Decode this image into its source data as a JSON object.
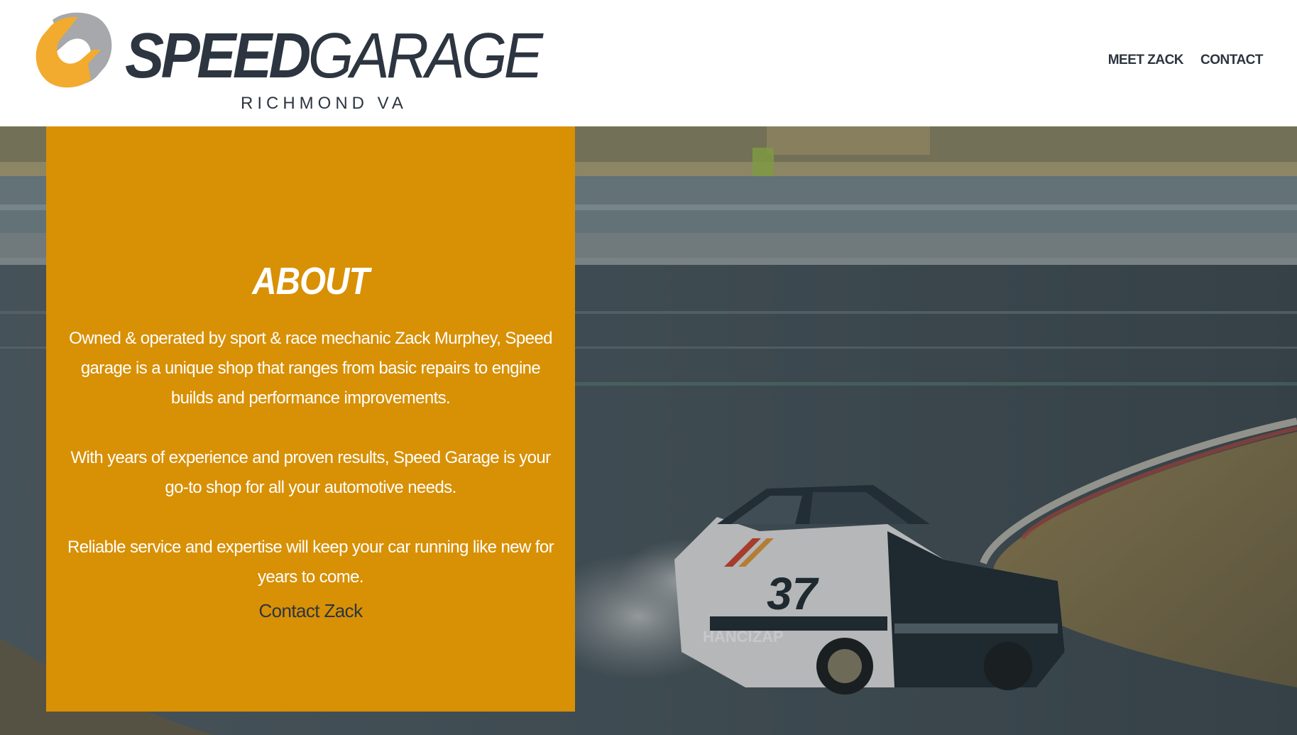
{
  "brand": {
    "name_bold": "SPEED",
    "name_light": "GARAGE",
    "location": "RICHMOND VA",
    "colors": {
      "accent_orange": "#f2ab2e",
      "mark_grey": "#a6a8ab",
      "text_dark": "#2c3540"
    }
  },
  "nav": {
    "items": [
      {
        "label": "MEET ZACK"
      },
      {
        "label": "CONTACT"
      }
    ]
  },
  "about": {
    "title": "ABOUT",
    "paragraphs": [
      "Owned & operated by sport & race mechanic Zack Murphey, Speed garage is a unique shop that ranges from basic repairs to engine builds and performance improvements.",
      "With years of experience and proven results, Speed Garage is your go-to shop for all your automotive needs.",
      "Reliable service and expertise will keep your car running like new for years to come."
    ],
    "cta_label": "Contact Zack",
    "panel_color": "#d89005"
  },
  "hero": {
    "car_number": "37",
    "car_sponsor": "HANCIZAP"
  }
}
